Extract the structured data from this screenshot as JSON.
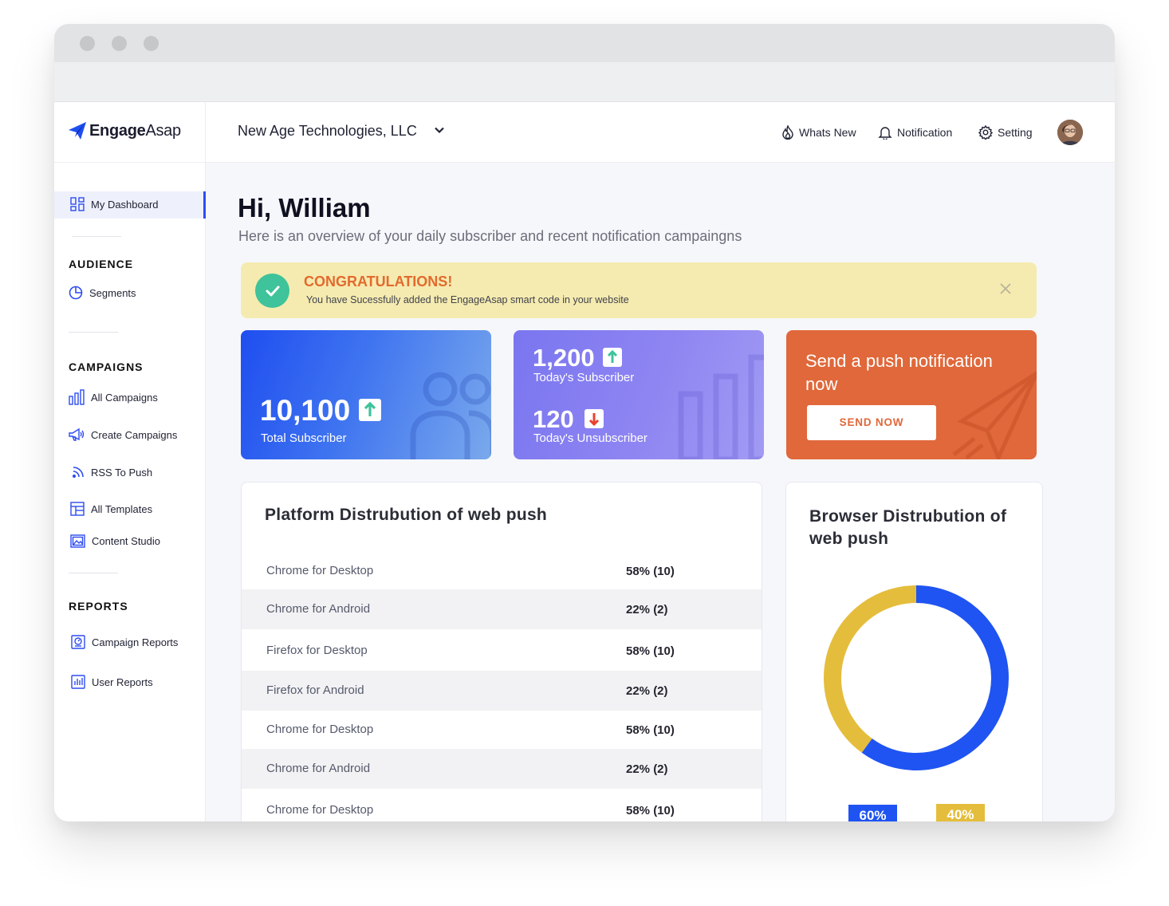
{
  "app": {
    "logo_bold": "Engage",
    "logo_light": "Asap"
  },
  "topbar": {
    "company": "New Age Technologies, LLC",
    "whats_new": "Whats New",
    "notification": "Notification",
    "setting": "Setting"
  },
  "sidebar": {
    "dashboard": "My Dashboard",
    "audience_title": "AUDIENCE",
    "segments": "Segments",
    "campaigns_title": "CAMPAIGNS",
    "all_campaigns": "All Campaigns",
    "create_campaigns": "Create Campaigns",
    "rss_to_push": "RSS To Push",
    "all_templates": "All Templates",
    "content_studio": "Content Studio",
    "reports_title": "REPORTS",
    "campaign_reports": "Campaign Reports",
    "user_reports": "User Reports"
  },
  "main": {
    "greeting": "Hi, William",
    "subtitle": "Here is an overview of your daily subscriber and recent notification campaingns",
    "banner": {
      "title": "CONGRATULATIONS!",
      "text": "You have Sucessfully added the EngageAsap smart code in your website"
    },
    "cards": {
      "total_value": "10,100",
      "total_label": "Total Subscriber",
      "today_sub_value": "1,200",
      "today_sub_label": "Today's Subscriber",
      "today_unsub_value": "120",
      "today_unsub_label": "Today's Unsubscriber",
      "send_title": "Send a push notification now",
      "send_button": "SEND NOW"
    },
    "platform": {
      "title": "Platform Distrubution of web push",
      "rows": [
        {
          "name": "Chrome for Desktop",
          "value": "58% (10)"
        },
        {
          "name": "Chrome for Android",
          "value": "22% (2)"
        },
        {
          "name": "Firefox for Desktop",
          "value": "58% (10)"
        },
        {
          "name": "Firefox for Android",
          "value": "22% (2)"
        },
        {
          "name": "Chrome for Desktop",
          "value": "58% (10)"
        },
        {
          "name": "Chrome for Android",
          "value": "22% (2)"
        },
        {
          "name": "Chrome for Desktop",
          "value": "58% (10)"
        }
      ]
    },
    "browser": {
      "title": "Browser Distrubution of web push",
      "segments": [
        {
          "label": "60%",
          "fraction": 0.6,
          "color": "#1f54f2"
        },
        {
          "label": "40%",
          "fraction": 0.4,
          "color": "#e5bd3c"
        }
      ]
    }
  },
  "colors": {
    "accent": "#2d4cf0",
    "orange": "#e0683a",
    "green": "#3ec39a",
    "yellow": "#e5bd3c"
  }
}
